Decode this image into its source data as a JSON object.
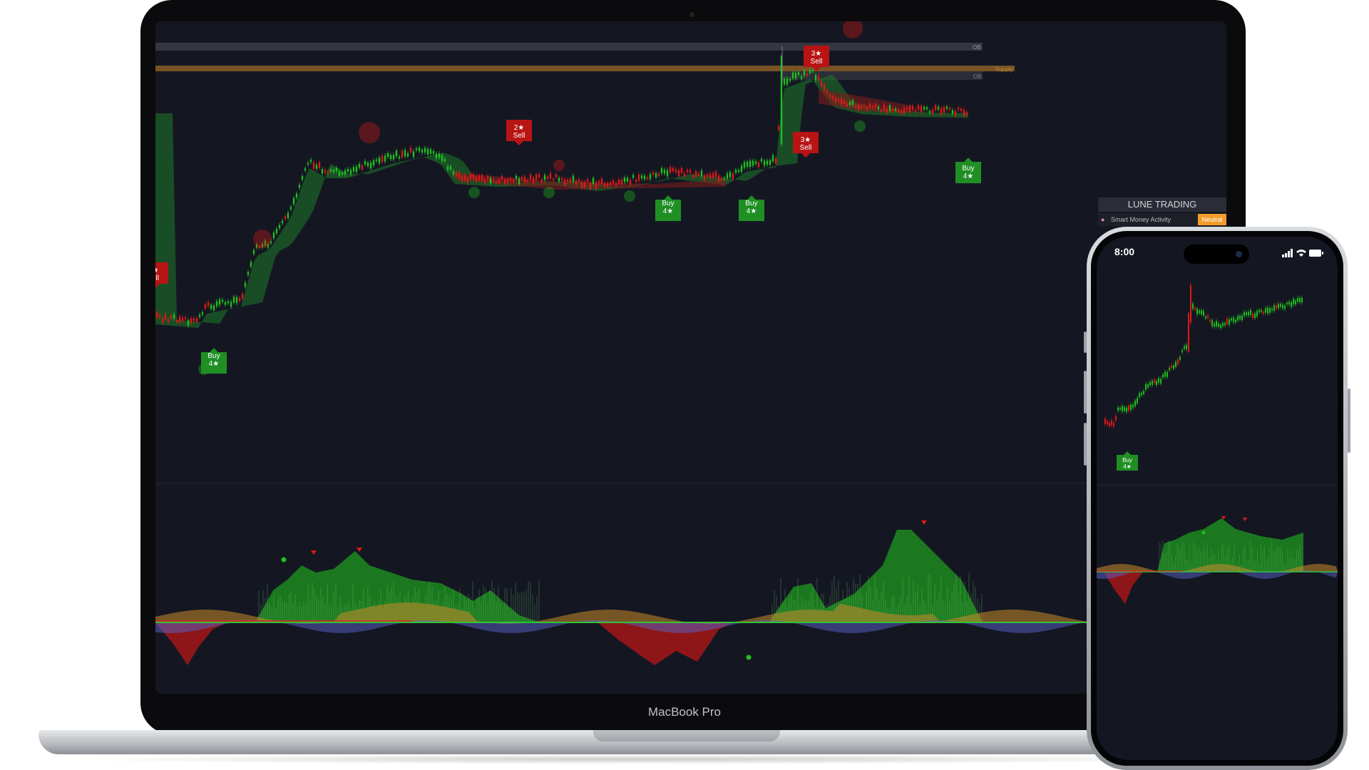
{
  "device_laptop": {
    "label": "MacBook Pro"
  },
  "device_phone": {
    "time": "8:00"
  },
  "panel": {
    "title": "LUNE TRADING",
    "row_label": "Smart Money Activity",
    "row_value": "Neutral"
  },
  "signals": [
    {
      "text1": "2★",
      "text2": "Sell",
      "type": "sell"
    },
    {
      "text1": "3★",
      "text2": "Sell",
      "type": "sell"
    },
    {
      "text1": "3★",
      "text2": "Sell",
      "type": "sell"
    },
    {
      "text1": "★",
      "text2": "ell",
      "type": "sell"
    },
    {
      "text1": "Buy",
      "text2": "4★",
      "type": "buy"
    },
    {
      "text1": "Buy",
      "text2": "4★",
      "type": "buy"
    },
    {
      "text1": "Buy",
      "text2": "4★",
      "type": "buy"
    },
    {
      "text1": "Buy",
      "text2": "4★",
      "type": "buy"
    },
    {
      "text1": "Buy",
      "text2": "4★",
      "type": "buy"
    }
  ],
  "zone_labels": {
    "ob": "OB",
    "ob2": "OB",
    "supply": "Supply"
  },
  "colors": {
    "bull": "#1fbf1f",
    "bear": "#e01818",
    "bg": "#141722",
    "zone_orange": "#f39c2b",
    "osc_orange": "#c98a2a",
    "osc_blue": "#5561c9"
  },
  "icons": [
    "camera-icon",
    "signal-bars-icon",
    "wifi-icon",
    "battery-icon",
    "brain-icon"
  ]
}
